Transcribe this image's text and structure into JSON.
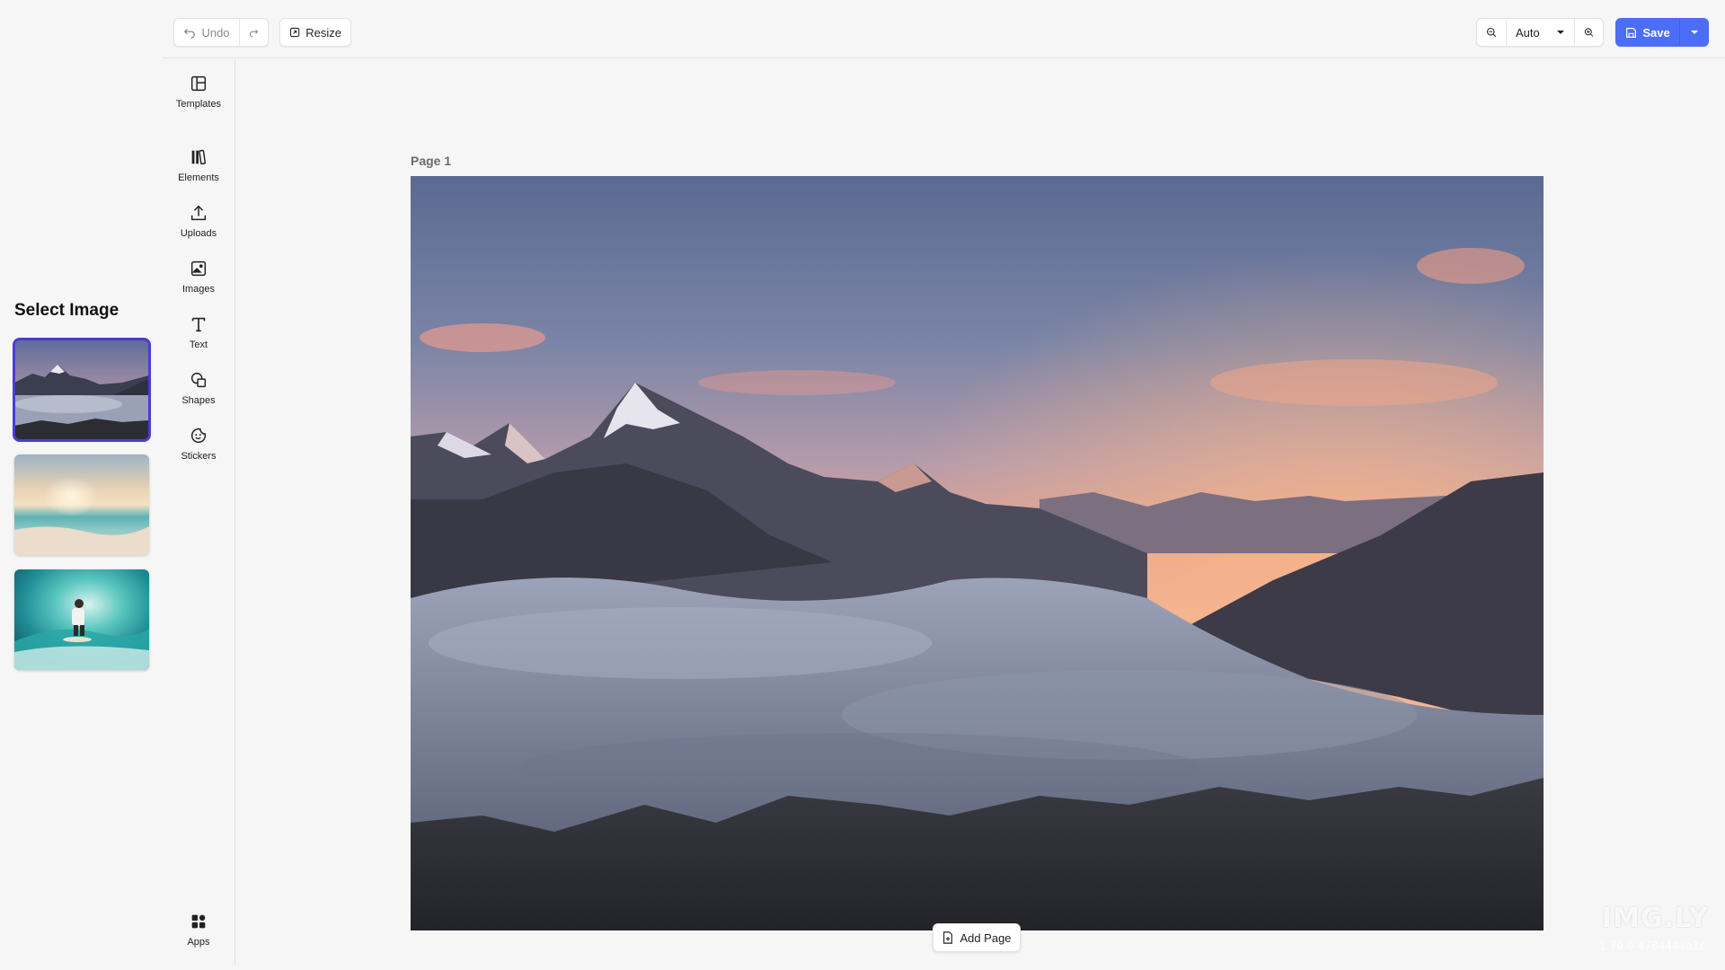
{
  "select_panel": {
    "title": "Select Image",
    "images": [
      {
        "name": "mountains-sunset",
        "selected": true
      },
      {
        "name": "beach-sunset",
        "selected": false
      },
      {
        "name": "surfer-wave",
        "selected": false
      }
    ],
    "selection_color": "#4b3bd6"
  },
  "toolbar": {
    "undo_label": "Undo",
    "redo_icon": "redo-icon",
    "resize_label": "Resize",
    "zoom_out_icon": "zoom-out-icon",
    "zoom_value": "Auto",
    "zoom_in_icon": "zoom-in-icon",
    "save_label": "Save",
    "accent": "#4c6df5"
  },
  "dock": {
    "items": [
      {
        "label": "Templates",
        "icon": "layout-icon"
      },
      {
        "label": "Elements",
        "icon": "library-icon"
      },
      {
        "label": "Uploads",
        "icon": "upload-icon"
      },
      {
        "label": "Images",
        "icon": "image-icon"
      },
      {
        "label": "Text",
        "icon": "text-icon"
      },
      {
        "label": "Shapes",
        "icon": "shapes-icon"
      },
      {
        "label": "Stickers",
        "icon": "sticker-icon"
      },
      {
        "label": "Apps",
        "icon": "apps-icon"
      }
    ]
  },
  "canvas": {
    "page_label": "Page 1",
    "add_page_label": "Add Page",
    "brand": "IMG.LY",
    "version": "1.70.0-4784449b1c"
  }
}
